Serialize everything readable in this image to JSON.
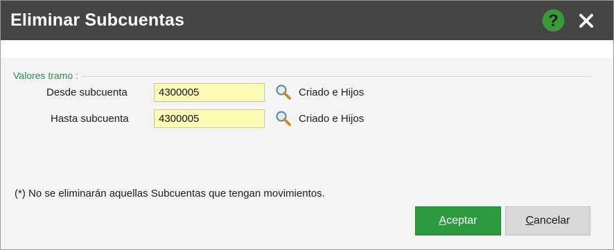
{
  "dialog": {
    "title": "Eliminar Subcuentas",
    "help_icon": "help-circle-icon",
    "close_icon": "close-icon"
  },
  "group": {
    "legend": "Valores tramo :"
  },
  "rows": [
    {
      "label": "Desde subcuenta",
      "value": "4300005",
      "search_icon": "search-icon",
      "owner": "Criado e Hijos"
    },
    {
      "label": "Hasta subcuenta",
      "value": "4300005",
      "search_icon": "search-icon",
      "owner": "Criado e Hijos"
    }
  ],
  "note": "(*) No se eliminarán aquellas Subcuentas que tengan movimientos.",
  "buttons": {
    "accept_first": "A",
    "accept_rest": "ceptar",
    "cancel_first": "C",
    "cancel_rest": "ancelar"
  },
  "colors": {
    "titlebar": "#454545",
    "accent_green": "#2e9a3f",
    "field_bg": "#fbfbb6",
    "legend_text": "#2e8b57"
  }
}
